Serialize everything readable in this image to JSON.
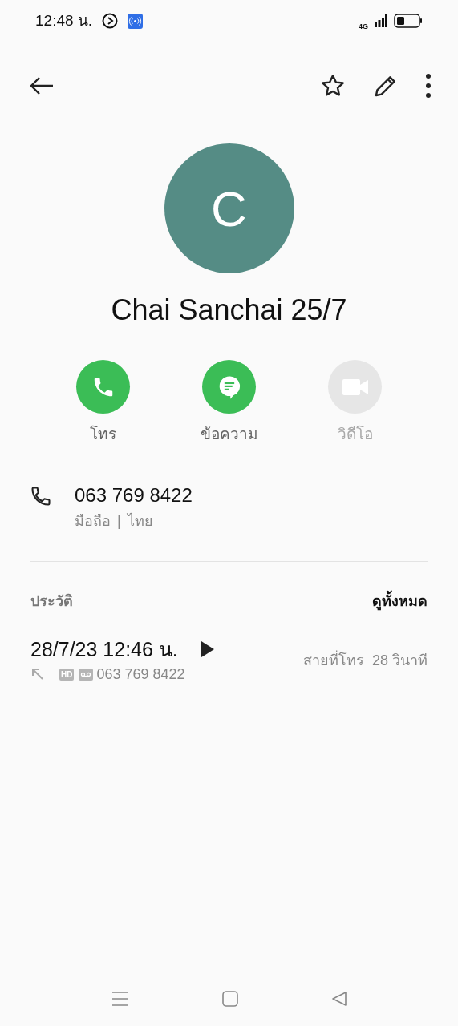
{
  "status_bar": {
    "time": "12:48 น.",
    "network": "4G"
  },
  "contact": {
    "initial": "C",
    "name": "Chai Sanchai 25/7"
  },
  "actions": [
    {
      "kind": "call",
      "label": "โทร",
      "disabled": false
    },
    {
      "kind": "message",
      "label": "ข้อความ",
      "disabled": false
    },
    {
      "kind": "video",
      "label": "วิดีโอ",
      "disabled": true
    }
  ],
  "phone": {
    "number": "063 769 8422",
    "type": "มือถือ",
    "separator": "|",
    "country": "ไทย"
  },
  "history": {
    "title": "ประวัติ",
    "see_all": "ดูทั้งหมด",
    "entries": [
      {
        "datetime": "28/7/23 12:46 น.",
        "badge": "HD",
        "number": "063 769 8422",
        "status": "สายที่โทร",
        "duration": "28 วินาที"
      }
    ]
  }
}
